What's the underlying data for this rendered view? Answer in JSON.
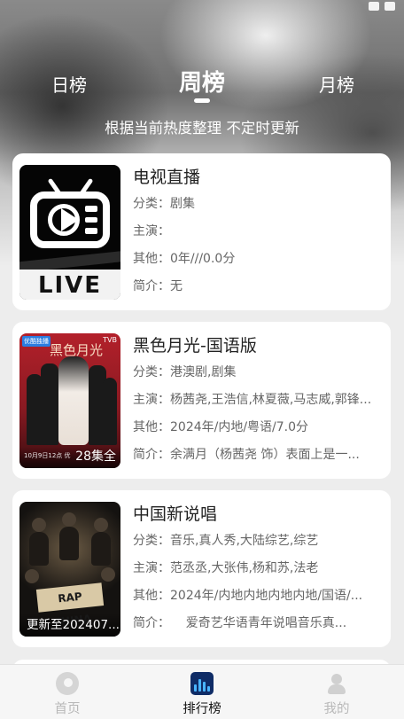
{
  "tabs": {
    "day": "日榜",
    "week": "周榜",
    "month": "月榜",
    "active": "week"
  },
  "subtitle": "根据当前热度整理 不定时更新",
  "labels": {
    "category": "分类：",
    "cast": "主演：",
    "other": "其他：",
    "intro": "简介："
  },
  "items": [
    {
      "title": "电视直播",
      "category": "剧集",
      "cast": "",
      "other": "0年///0.0分",
      "intro": "无",
      "poster": {
        "icon": "tv-live-icon",
        "band_text": "LIVE"
      }
    },
    {
      "title": "黑色月光-国语版",
      "category": "港澳剧,剧集",
      "cast": "杨茜尧,王浩信,林夏薇,马志威,郭锋...",
      "other": "2024年/内地/粤语/7.0分",
      "intro": "余满月（杨茜尧 饰）表面上是一...",
      "poster": {
        "title_text": "黑色月光",
        "badge_left": "优酷独播",
        "badge_right": "TVB",
        "date_text": "10月9日12点 优",
        "overlay_text": "28集全"
      }
    },
    {
      "title": "中国新说唱",
      "category": "音乐,真人秀,大陆综艺,综艺",
      "cast": "范丞丞,大张伟,杨和苏,法老",
      "other": "2024年/内地内地内地内地/国语/...",
      "intro": "    爱奇艺华语青年说唱音乐真...",
      "poster": {
        "logo_text": "RAP CHINA",
        "overlay_text": "更新至202407..."
      }
    }
  ],
  "bottom_nav": [
    {
      "label": "首页",
      "icon": "home-icon",
      "active": false
    },
    {
      "label": "排行榜",
      "icon": "ranking-chart-icon",
      "active": true
    },
    {
      "label": "我的",
      "icon": "profile-icon",
      "active": false
    }
  ],
  "colors": {
    "accent_nav_icon": "#0f2c66",
    "active_nav_label": "#111111",
    "inactive_nav_label": "#b8b8b8"
  }
}
